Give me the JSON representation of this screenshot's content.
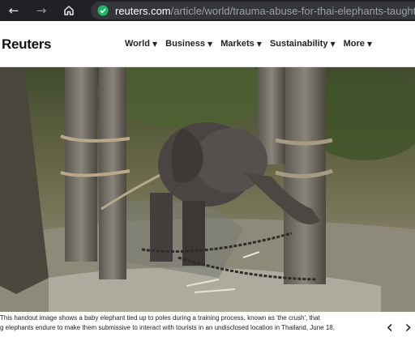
{
  "browser": {
    "url_host": "reuters.com",
    "url_path": "/article/world/trauma-abuse-for-thai-elephants-taught-tri",
    "back_icon": "arrow-left-icon",
    "forward_icon": "arrow-right-icon",
    "home_icon": "home-icon",
    "security_icon": "shield-check-icon",
    "security_color": "#1fb86b"
  },
  "site": {
    "logo": "Reuters",
    "nav": [
      {
        "label": "World"
      },
      {
        "label": "Business"
      },
      {
        "label": "Markets"
      },
      {
        "label": "Sustainability"
      },
      {
        "label": "More"
      }
    ]
  },
  "article": {
    "image_alt": "Baby elephant tied up to poles",
    "caption_line1": "This handout image shows a baby elephant tied up to poles during a training process, known as 'the crush', that",
    "caption_line2": "g elephants endure to make them submissive to interact with tourists in an undisclosed location in Thailand, June 18,",
    "prev_icon": "chevron-left-icon",
    "next_icon": "chevron-right-icon"
  }
}
